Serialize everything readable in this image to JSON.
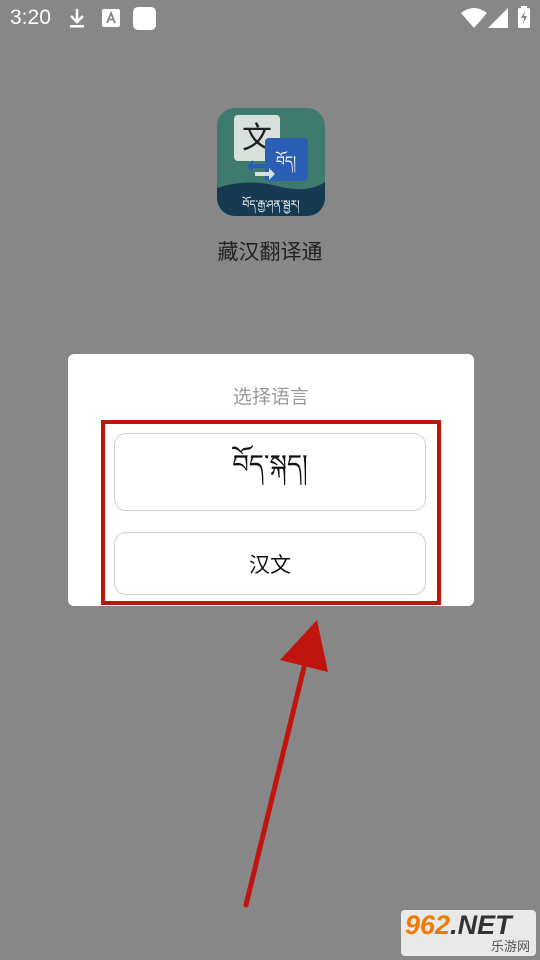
{
  "status_bar": {
    "time": "3:20",
    "left_icons": [
      "download-icon",
      "a-notification-icon",
      "square-notification-icon"
    ],
    "right_icons": [
      "wifi-icon",
      "signal-icon",
      "battery-charging-icon"
    ]
  },
  "app": {
    "name": "藏汉翻译通",
    "icon_text_top": "文",
    "icon_text_right": "བོད།",
    "icon_text_bottom": "བོད་རྒྱ་ཤན་སྦྱར།"
  },
  "dialog": {
    "title": "选择语言",
    "options": [
      {
        "label": "བོད་སྐད།"
      },
      {
        "label": "汉文"
      }
    ]
  },
  "overlay": {
    "highlight_color": "#c0150f",
    "arrow_color": "#c0150f"
  },
  "watermark": {
    "brand_num": "962",
    "brand_suffix": ".NET",
    "subtitle": "乐游网"
  }
}
